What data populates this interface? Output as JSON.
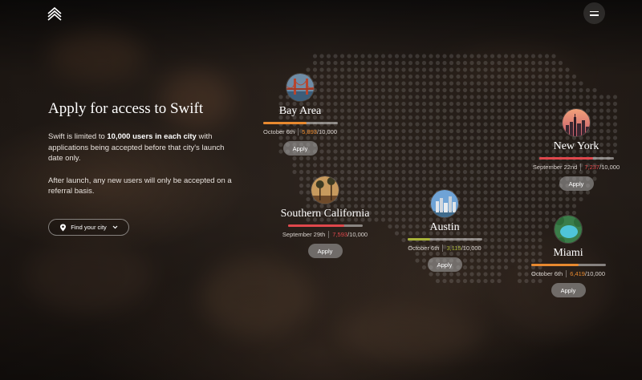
{
  "header": {
    "logo_icon": "chevron-stack-icon",
    "menu_icon": "hamburger-menu-icon"
  },
  "intro": {
    "title": "Apply for access to Swift",
    "para1_start": "Swift is limited to ",
    "para1_bold": "10,000 users in each city",
    "para1_end": " with applications being accepted before that city's launch date only.",
    "para2": "After launch, any new users will only be accepted on a referral basis.",
    "find_city_label": "Find your city",
    "find_city_icon": "location-pin-icon"
  },
  "cities": [
    {
      "name": "Bay Area",
      "date": "October 6th",
      "count": "5,893",
      "limit": "/10,000",
      "progress": 0.5893,
      "color": "#e8892f",
      "apply_label": "Apply",
      "thumb": "golden-gate-bridge"
    },
    {
      "name": "New York",
      "date": "September 22nd",
      "count": "7,237",
      "limit": "/10,000",
      "progress": 0.7237,
      "color": "#e0474c",
      "apply_label": "Apply",
      "thumb": "new-york-skyline"
    },
    {
      "name": "Southern California",
      "date": "September 29th",
      "count": "7,593",
      "limit": "/10,000",
      "progress": 0.7593,
      "color": "#e0474c",
      "apply_label": "Apply",
      "thumb": "palm-trees"
    },
    {
      "name": "Austin",
      "date": "October 6th",
      "count": "3,115",
      "limit": "/10,000",
      "progress": 0.3115,
      "color": "#a9b43a",
      "apply_label": "Apply",
      "thumb": "austin-skyline"
    },
    {
      "name": "Miami",
      "date": "October 6th",
      "count": "6,419",
      "limit": "/10,000",
      "progress": 0.6419,
      "color": "#e8892f",
      "apply_label": "Apply",
      "thumb": "miami-pool"
    }
  ]
}
